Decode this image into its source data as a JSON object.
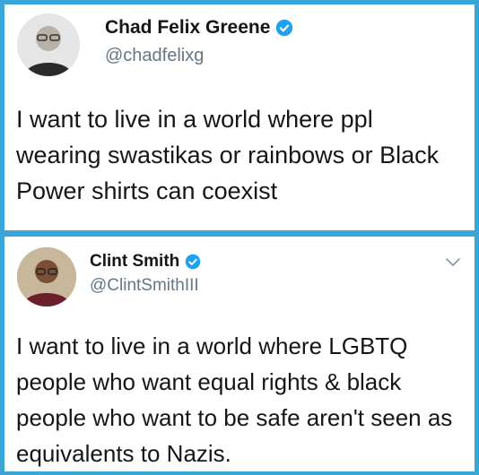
{
  "tweets": [
    {
      "display_name": "Chad Felix Greene",
      "handle": "@chadfelixg",
      "verified": true,
      "text": "I want to live in a world where ppl wearing swastikas or rainbows or Black Power shirts can coexist"
    },
    {
      "display_name": "Clint Smith",
      "handle": "@ClintSmithIII",
      "verified": true,
      "text": "I want to live in a world where LGBTQ people who want equal rights & black people who want to be safe aren't seen as equivalents to Nazis."
    }
  ],
  "colors": {
    "frame": "#3aa6d8",
    "verified_badge": "#1da1f2",
    "handle_gray": "#657786"
  },
  "icons": [
    "verified-badge-icon",
    "chevron-down-icon"
  ]
}
